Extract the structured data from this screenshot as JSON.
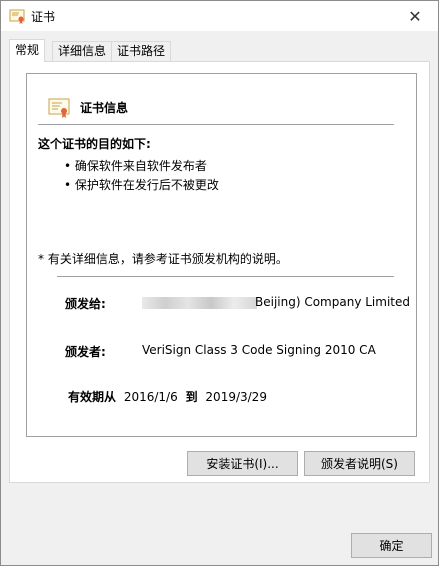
{
  "window": {
    "title": "证书",
    "close_glyph": "✕"
  },
  "tabs": [
    {
      "label": "常规",
      "active": true
    },
    {
      "label": "详细信息",
      "active": false
    },
    {
      "label": "证书路径",
      "active": false
    }
  ],
  "general": {
    "info_title": "证书信息",
    "purpose_heading": "这个证书的目的如下:",
    "purposes": [
      "确保软件来自软件发布者",
      "保护软件在发行后不被更改"
    ],
    "note": "* 有关详细信息，请参考证书颁发机构的说明。",
    "issued_to_label": "颁发给:",
    "issued_to_value": "Beijing) Company Limited",
    "issued_by_label": "颁发者:",
    "issued_by_value": "VeriSign Class 3 Code Signing 2010 CA",
    "valid_from_label": "有效期从",
    "valid_from": "2016/1/6",
    "valid_to_label": "到",
    "valid_to": "2019/3/29"
  },
  "buttons": {
    "install": "安装证书(I)...",
    "issuer_statement": "颁发者说明(S)",
    "ok": "确定"
  },
  "icons": {
    "title": "certificate-icon",
    "info": "certificate-icon"
  }
}
